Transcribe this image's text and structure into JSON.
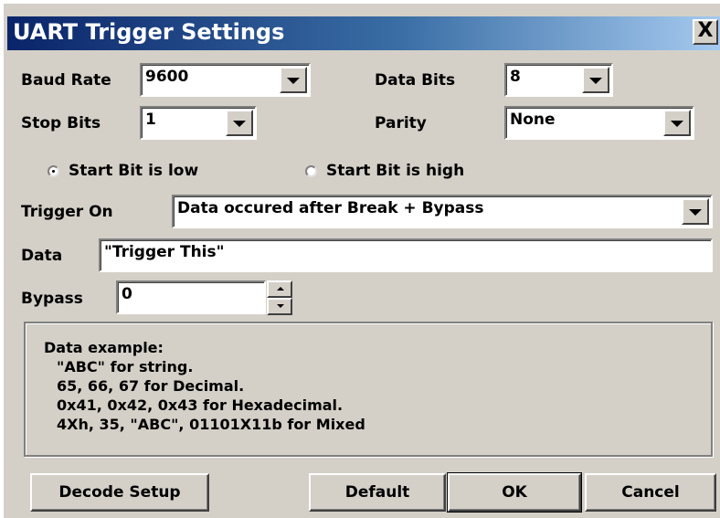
{
  "window": {
    "title": "UART Trigger Settings",
    "close_label": "X"
  },
  "baud_rate": {
    "label": "Baud Rate",
    "value": "9600"
  },
  "data_bits": {
    "label": "Data Bits",
    "value": "8"
  },
  "stop_bits": {
    "label": "Stop Bits",
    "value": "1"
  },
  "parity": {
    "label": "Parity",
    "value": "None"
  },
  "start_bit": {
    "options": [
      {
        "label": "Start Bit is low",
        "selected": true
      },
      {
        "label": "Start Bit is high",
        "selected": false
      }
    ]
  },
  "trigger_on": {
    "label": "Trigger On",
    "value": "Data occured after Break + Bypass"
  },
  "data_field": {
    "label": "Data",
    "value": "\"Trigger This\""
  },
  "bypass": {
    "label": "Bypass",
    "value": "0"
  },
  "example": {
    "title": "Data example:",
    "lines": [
      "\"ABC\" for string.",
      "65, 66, 67 for Decimal.",
      "0x41, 0x42, 0x43 for Hexadecimal.",
      "4Xh, 35, \"ABC\", 01101X11b for Mixed"
    ]
  },
  "buttons": {
    "decode_setup": "Decode Setup",
    "default": "Default",
    "ok": "OK",
    "cancel": "Cancel"
  },
  "colors": {
    "dialog_bg": "#d4d0c8",
    "title_start": "#0a246a",
    "title_end": "#a6caf0"
  }
}
